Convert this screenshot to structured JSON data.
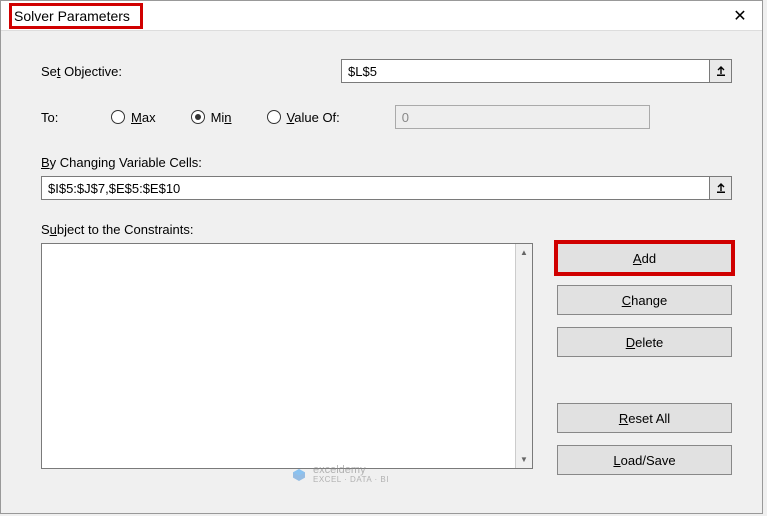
{
  "title": "Solver Parameters",
  "labels": {
    "set_objective": "Set Objective:",
    "to": "To:",
    "max": "Max",
    "min": "Min",
    "value_of": "Value Of:",
    "by_changing": "By Changing Variable Cells:",
    "subject_to": "Subject to the Constraints:"
  },
  "inputs": {
    "objective": "$L$5",
    "value_of": "0",
    "changing_cells": "$I$5:$J$7,$E$5:$E$10"
  },
  "buttons": {
    "add": "Add",
    "change": "Change",
    "delete": "Delete",
    "reset_all": "Reset All",
    "load_save": "Load/Save"
  },
  "watermark": {
    "name": "exceldemy",
    "sub": "EXCEL · DATA · BI"
  }
}
